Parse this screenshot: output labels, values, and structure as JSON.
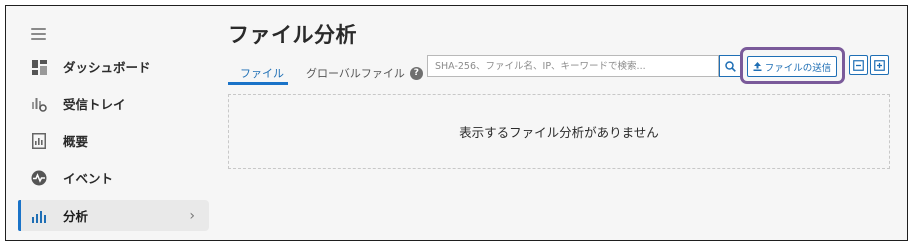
{
  "sidebar": {
    "items": [
      {
        "label": "ダッシュボード",
        "icon": "dashboard-icon"
      },
      {
        "label": "受信トレイ",
        "icon": "inbox-tray-icon"
      },
      {
        "label": "概要",
        "icon": "report-icon"
      },
      {
        "label": "イベント",
        "icon": "pulse-icon"
      },
      {
        "label": "分析",
        "icon": "bar-chart-icon",
        "active": true
      }
    ]
  },
  "main": {
    "title": "ファイル分析",
    "tabs": [
      {
        "label": "ファイル",
        "active": true
      },
      {
        "label": "グローバルファイル"
      }
    ],
    "help_badge": "?",
    "search": {
      "placeholder": "SHA-256、ファイル名、IP、キーワードで検索..."
    },
    "submit_button_label": "ファイルの送信",
    "empty_message": "表示するファイル分析がありません"
  },
  "colors": {
    "accent": "#1a73c8",
    "highlight_outline": "#7a5a9a"
  }
}
